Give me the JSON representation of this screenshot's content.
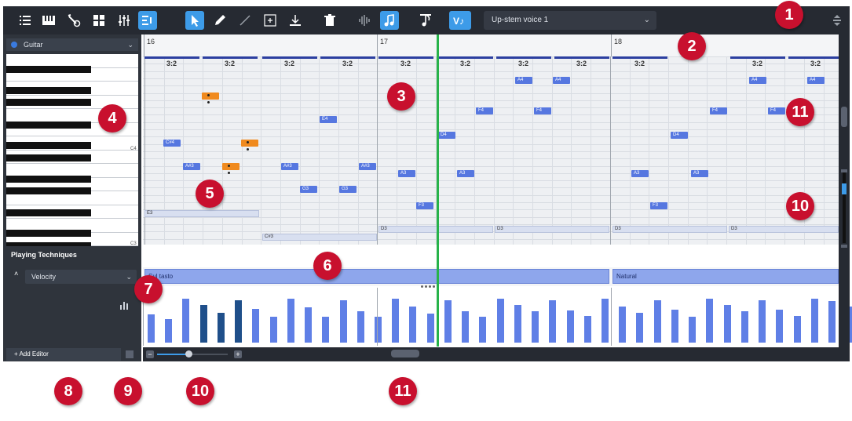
{
  "toolbar": {
    "voice_select_value": "Up-stem voice 1",
    "tools": [
      "list-icon",
      "piano-keys-icon",
      "guitar-icon",
      "grid-icon",
      "mixer-icon",
      "step-edit-icon",
      "arrow-select-icon",
      "pencil-icon",
      "line-icon",
      "expand-icon",
      "align-bottom-icon",
      "trash-icon",
      "waveform-icon",
      "note-icon",
      "flag-note-icon",
      "voice-icon"
    ]
  },
  "left_panel": {
    "instrument": "Guitar",
    "key_labels": [
      "C4",
      "C3"
    ],
    "playing_techniques_label": "Playing Techniques",
    "velocity_label": "Velocity",
    "add_editor_label": "+ Add Editor"
  },
  "ruler": {
    "bars": [
      "16",
      "17",
      "18"
    ]
  },
  "tuplets": [
    "3:2",
    "3:2",
    "3:2",
    "3:2",
    "3:2",
    "3:2",
    "3:2",
    "3:2",
    "3:2",
    "3:2",
    "3:2"
  ],
  "notes": [
    {
      "label": "A4"
    },
    {
      "label": "A4"
    },
    {
      "label": "A4"
    },
    {
      "label": "A4"
    },
    {
      "label": ""
    },
    {
      "label": "E4"
    },
    {
      "label": "F4"
    },
    {
      "label": "F4"
    },
    {
      "label": "F4"
    },
    {
      "label": "F4"
    },
    {
      "label": "D4"
    },
    {
      "label": "D4"
    },
    {
      "label": "C#4"
    },
    {
      "label": ""
    },
    {
      "label": "A#3"
    },
    {
      "label": ""
    },
    {
      "label": "A#3"
    },
    {
      "label": "A#3"
    },
    {
      "label": "A3"
    },
    {
      "label": "A3"
    },
    {
      "label": "A3"
    },
    {
      "label": "A3"
    },
    {
      "label": "G3"
    },
    {
      "label": "G3"
    },
    {
      "label": "F3"
    },
    {
      "label": "F3"
    }
  ],
  "long_notes": [
    "E3",
    "C#3",
    "D3",
    "D3",
    "D3",
    "D3"
  ],
  "playing_techniques": [
    "Sul tasto",
    "Natural"
  ],
  "velocity_values": [
    0.55,
    0.45,
    0.85,
    0.72,
    0.58,
    0.82,
    0.65,
    0.5,
    0.85,
    0.68,
    0.5,
    0.82,
    0.6,
    0.5,
    0.85,
    0.7,
    0.56,
    0.82,
    0.6,
    0.5,
    0.85,
    0.72,
    0.6,
    0.82,
    0.62,
    0.52,
    0.85,
    0.7,
    0.58,
    0.82,
    0.64,
    0.5,
    0.85,
    0.72,
    0.6,
    0.82,
    0.64,
    0.52,
    0.85,
    0.8,
    0.7
  ],
  "callouts": [
    "1",
    "2",
    "3",
    "4",
    "5",
    "6",
    "7",
    "8",
    "9",
    "10",
    "10",
    "11",
    "11"
  ],
  "colors": {
    "toolbar_bg": "#262a32",
    "accent": "#3d9be8",
    "note": "#5677e0",
    "selected_note": "#f08a1e",
    "playhead": "#27b34a",
    "callout": "#c8102e",
    "tuplet_bar": "#2c3fa0"
  }
}
